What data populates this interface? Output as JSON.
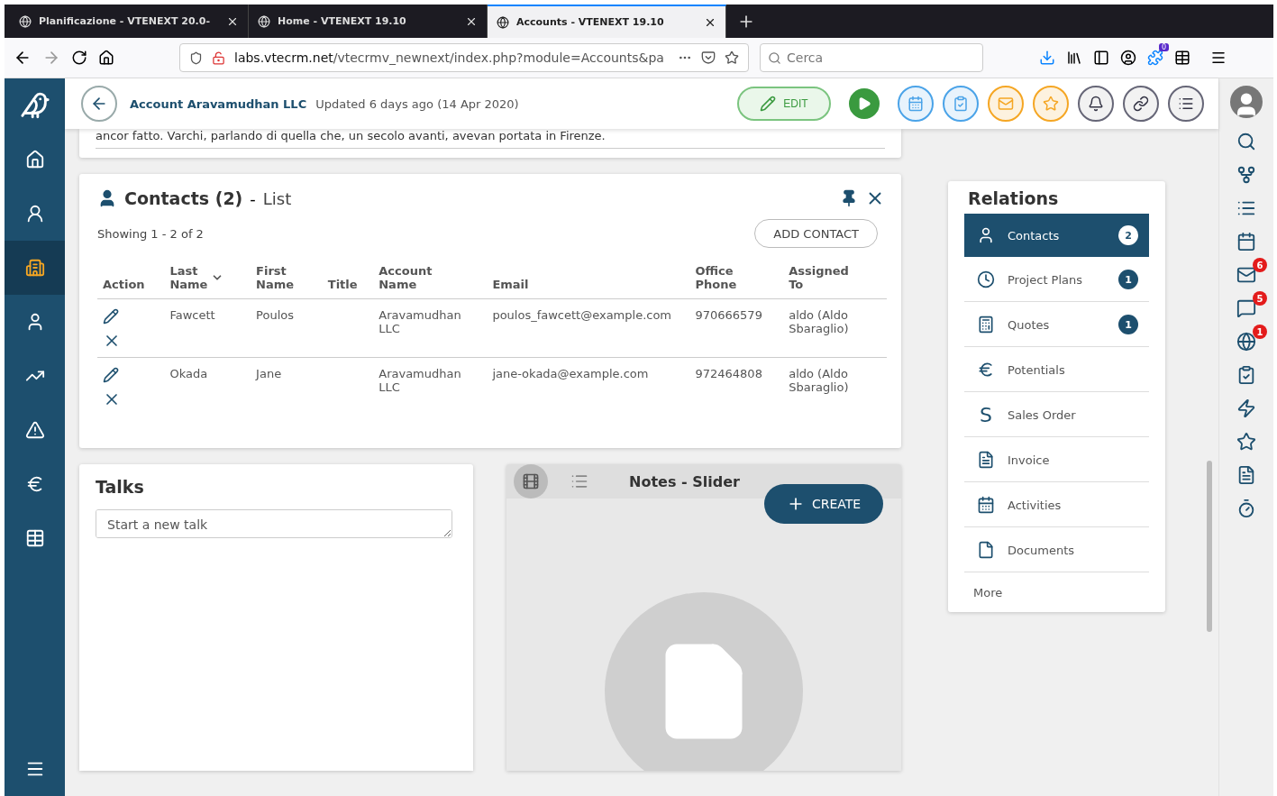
{
  "browser": {
    "tabs": [
      {
        "title": "Planificazione - VTENEXT 20.0-",
        "selected": false
      },
      {
        "title": "Home - VTENEXT 19.10",
        "selected": false
      },
      {
        "title": "Accounts - VTENEXT 19.10",
        "selected": true
      }
    ],
    "address": {
      "host": "labs.vtecrm.net",
      "path": "/vtecrmv_newnext/index.php?module=Accounts&pa"
    },
    "search": {
      "placeholder": "Cerca"
    },
    "extension_badge": "0"
  },
  "sidebar": {
    "items": [
      {
        "kind": "home",
        "selected": false
      },
      {
        "kind": "user-outline",
        "selected": false
      },
      {
        "kind": "building",
        "selected": true
      },
      {
        "kind": "user",
        "selected": false
      },
      {
        "kind": "trend",
        "selected": false
      },
      {
        "kind": "alert",
        "selected": false
      },
      {
        "kind": "euro",
        "selected": false
      },
      {
        "kind": "table",
        "selected": false
      }
    ]
  },
  "header": {
    "title": "Account Aravamudhan LLC",
    "updated": "Updated 6 days ago (14 Apr 2020)",
    "edit": "EDIT"
  },
  "description": {
    "text": "ancor fatto. Varchi, parlando di quella che, un secolo avanti, avevan portata in Firenze."
  },
  "contacts": {
    "title": "Contacts (2)",
    "separator": "-",
    "view": "List",
    "showing": "Showing 1 - 2 of 2",
    "add": "ADD CONTACT",
    "columns": [
      {
        "label": "Action",
        "sorted": false
      },
      {
        "label": "Last Name",
        "sorted": true
      },
      {
        "label": "First Name",
        "sorted": false
      },
      {
        "label": "Title",
        "sorted": false
      },
      {
        "label": "Account Name",
        "sorted": false
      },
      {
        "label": "Email",
        "sorted": false
      },
      {
        "label": "Office Phone",
        "sorted": false
      },
      {
        "label": "Assigned To",
        "sorted": false
      }
    ],
    "rows": [
      {
        "last": "Fawcett",
        "first": "Poulos",
        "account": "Aravamudhan LLC",
        "email": "poulos_fawcett@example.com",
        "phone": "970666579",
        "assigned": "aldo (Aldo Sbaraglio)"
      },
      {
        "last": "Okada",
        "first": "Jane",
        "account": "Aravamudhan LLC",
        "email": "jane-okada@example.com",
        "phone": "972464808",
        "assigned": "aldo (Aldo Sbaraglio)"
      }
    ]
  },
  "talks": {
    "title": "Talks",
    "placeholder": "Start a new talk"
  },
  "notes": {
    "title": "Notes - Slider",
    "create": "CREATE",
    "views": [
      {
        "kind": "slider",
        "selected": true
      },
      {
        "kind": "list",
        "selected": false
      }
    ]
  },
  "relations": {
    "title": "Relations",
    "more": "More",
    "items": [
      {
        "kind": "user",
        "label": "Contacts",
        "count": "2",
        "selected": true
      },
      {
        "kind": "clock",
        "label": "Project Plans",
        "count": "1",
        "selected": false
      },
      {
        "kind": "calculator",
        "label": "Quotes",
        "count": "1",
        "selected": false
      },
      {
        "kind": "euro",
        "label": "Potentials",
        "selected": false
      },
      {
        "kind": "dollar",
        "symbol": "S",
        "label": "Sales Order",
        "selected": false
      },
      {
        "kind": "file",
        "label": "Invoice",
        "selected": false
      },
      {
        "kind": "calendar",
        "label": "Activities",
        "selected": false
      },
      {
        "kind": "document",
        "label": "Documents",
        "selected": false
      }
    ]
  },
  "rightbar": {
    "items": [
      {
        "kind": "search"
      },
      {
        "kind": "split"
      },
      {
        "kind": "list"
      },
      {
        "kind": "calendar"
      },
      {
        "kind": "mail",
        "badge": "6"
      },
      {
        "kind": "chat",
        "badge": "5"
      },
      {
        "kind": "globe",
        "badge": "1"
      },
      {
        "kind": "check"
      },
      {
        "kind": "bolt"
      },
      {
        "kind": "star"
      },
      {
        "kind": "file"
      },
      {
        "kind": "timer"
      }
    ]
  }
}
